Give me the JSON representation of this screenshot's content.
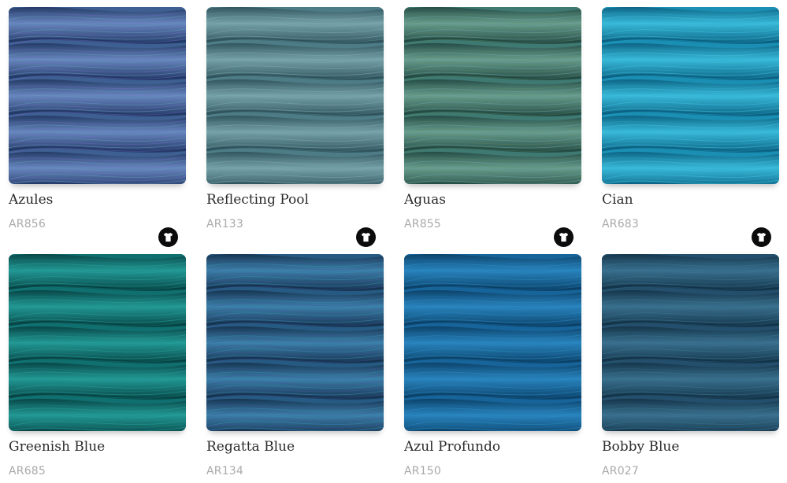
{
  "colorways": [
    {
      "name": "Azules",
      "code": "AR856",
      "colors": {
        "base": "#3e5f92",
        "light": "#6d8fc4",
        "dark": "#1f3560",
        "accent": "#7a6ad0"
      },
      "icon": "t-shirt-icon"
    },
    {
      "name": "Reflecting Pool",
      "code": "AR133",
      "colors": {
        "base": "#4d7c86",
        "light": "#7fa9b1",
        "dark": "#2c4f57",
        "accent": "#5f8f98"
      },
      "icon": "t-shirt-icon"
    },
    {
      "name": "Aguas",
      "code": "AR855",
      "colors": {
        "base": "#3f7a72",
        "light": "#6fa394",
        "dark": "#20453f",
        "accent": "#5e8a5a"
      },
      "icon": "t-shirt-icon"
    },
    {
      "name": "Cian",
      "code": "AR683",
      "colors": {
        "base": "#1a8fb3",
        "light": "#3fc1e0",
        "dark": "#0a5d7d",
        "accent": "#2aa9cf"
      },
      "icon": "t-shirt-icon"
    },
    {
      "name": "Greenish Blue",
      "code": "AR685",
      "colors": {
        "base": "#10706f",
        "light": "#26a09b",
        "dark": "#063f40",
        "accent": "#1a8a86"
      },
      "icon": "t-shirt-icon"
    },
    {
      "name": "Regatta Blue",
      "code": "AR134",
      "colors": {
        "base": "#265a82",
        "light": "#3f86b0",
        "dark": "#142f4b",
        "accent": "#4a4f9a"
      },
      "icon": "t-shirt-icon"
    },
    {
      "name": "Azul Profundo",
      "code": "AR150",
      "colors": {
        "base": "#17649a",
        "light": "#2c8ac4",
        "dark": "#0a3d62",
        "accent": "#1f74ad"
      },
      "icon": "t-shirt-icon"
    },
    {
      "name": "Bobby Blue",
      "code": "AR027",
      "colors": {
        "base": "#244f6c",
        "light": "#3d7694",
        "dark": "#123145",
        "accent": "#2e6383"
      },
      "icon": "t-shirt-icon"
    }
  ]
}
